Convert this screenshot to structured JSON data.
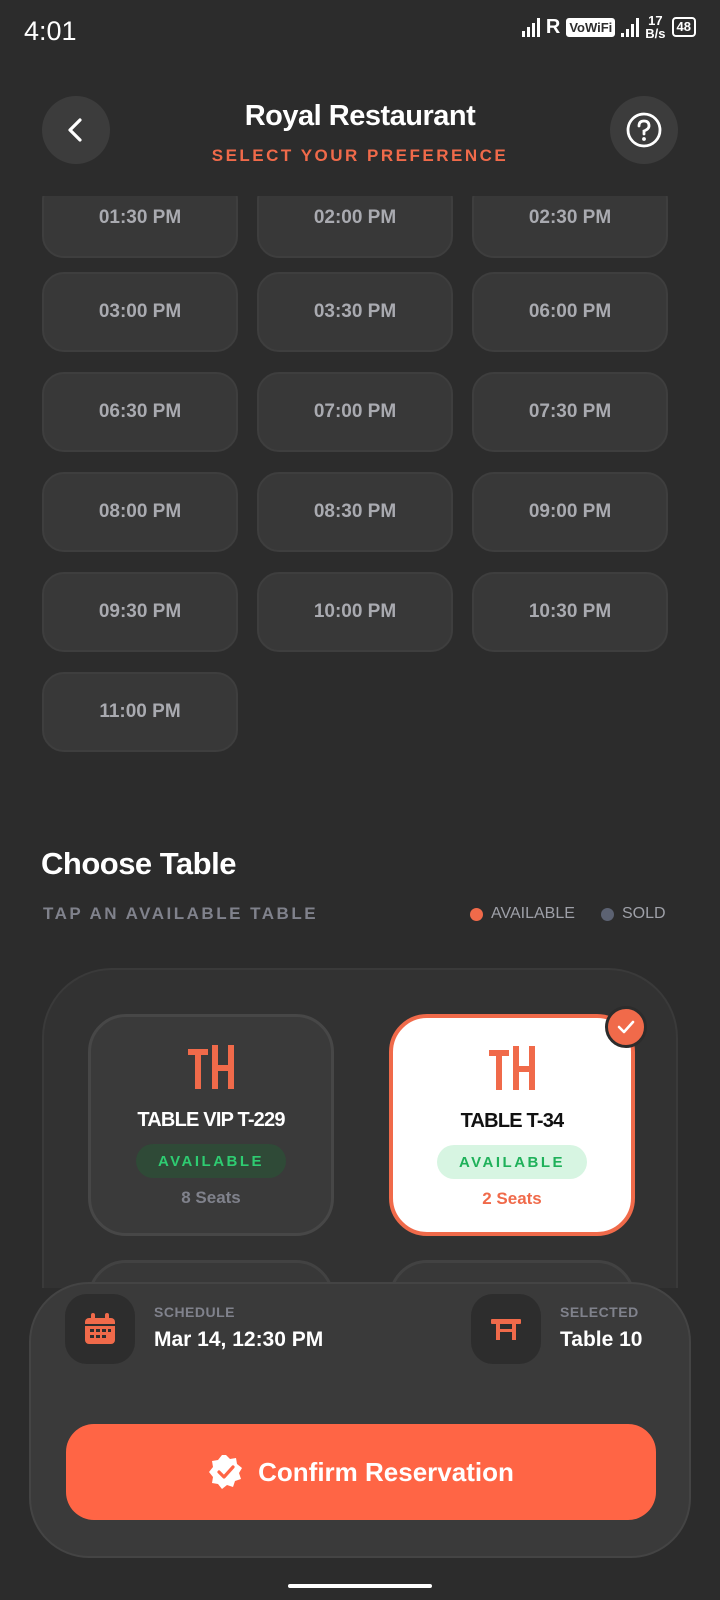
{
  "status_bar": {
    "time": "4:01",
    "carrier_letter": "R",
    "vowifi": "VoWiFi",
    "speed_value": "17",
    "speed_unit": "B/s",
    "battery": "48"
  },
  "header": {
    "title": "Royal Restaurant",
    "subtitle": "SELECT YOUR PREFERENCE"
  },
  "times": [
    "01:30 PM",
    "02:00 PM",
    "02:30 PM",
    "03:00 PM",
    "03:30 PM",
    "06:00 PM",
    "06:30 PM",
    "07:00 PM",
    "07:30 PM",
    "08:00 PM",
    "08:30 PM",
    "09:00 PM",
    "09:30 PM",
    "10:00 PM",
    "10:30 PM",
    "11:00 PM"
  ],
  "tables_section": {
    "title": "Choose Table",
    "subtitle": "TAP AN AVAILABLE TABLE",
    "legend_available": "AVAILABLE",
    "legend_sold": "SOLD",
    "legend_available_color": "#f06a4a",
    "legend_sold_color": "#5c6272"
  },
  "tables": [
    {
      "name": "TABLE VIP T-229",
      "status": "AVAILABLE",
      "seats": "8 Seats",
      "selected": false
    },
    {
      "name": "TABLE T-34",
      "status": "AVAILABLE",
      "seats": "2 Seats",
      "selected": true
    }
  ],
  "summary": {
    "schedule_label": "SCHEDULE",
    "schedule_value": "Mar 14, 12:30 PM",
    "selected_label": "SELECTED",
    "selected_value": "Table 10",
    "confirm_label": "Confirm Reservation"
  },
  "colors": {
    "accent": "#ff6545",
    "background": "#2c2c2c",
    "available_green": "#2ecc71"
  }
}
